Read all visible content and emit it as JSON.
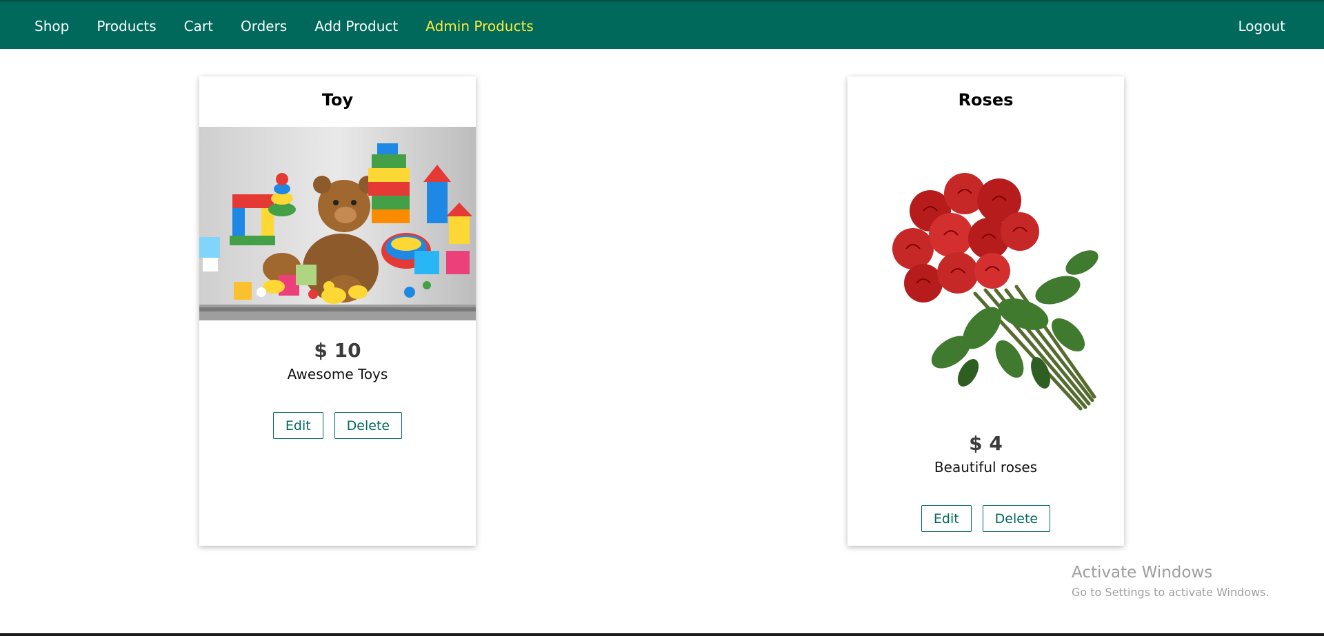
{
  "nav": {
    "items": [
      {
        "label": "Shop"
      },
      {
        "label": "Products"
      },
      {
        "label": "Cart"
      },
      {
        "label": "Orders"
      },
      {
        "label": "Add Product"
      },
      {
        "label": "Admin Products"
      }
    ],
    "active_index": 5,
    "logout_label": "Logout"
  },
  "products": [
    {
      "title": "Toy",
      "price": "$ 10",
      "description": "Awesome Toys",
      "edit_label": "Edit",
      "delete_label": "Delete",
      "image": "toys-photo"
    },
    {
      "title": "Roses",
      "price": "$ 4",
      "description": "Beautiful roses",
      "edit_label": "Edit",
      "delete_label": "Delete",
      "image": "roses-bouquet-photo"
    }
  ],
  "watermark": {
    "title": "Activate Windows",
    "subtitle": "Go to Settings to activate Windows."
  },
  "colors": {
    "header": "#00695c",
    "active_nav": "#ffeb3b",
    "button_border": "#00695c"
  }
}
